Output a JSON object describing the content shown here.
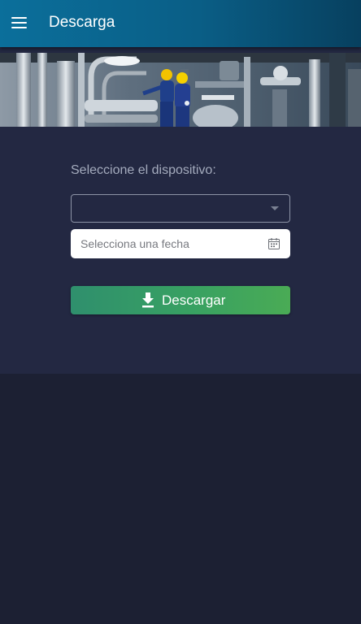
{
  "appbar": {
    "title": "Descarga",
    "menu_icon": "menu-icon"
  },
  "banner": {
    "image": "industrial-plant-workers-photo"
  },
  "form": {
    "device_label": "Seleccione el dispositivo:",
    "device_value": "",
    "date_placeholder": "Selecciona una fecha",
    "date_icon": "calendar-icon",
    "download_label": "Descargar",
    "download_icon": "download-icon"
  },
  "colors": {
    "appbar": "#0b6f9b",
    "background": "#1c2033",
    "panel": "#232842",
    "button": "#38a162"
  }
}
